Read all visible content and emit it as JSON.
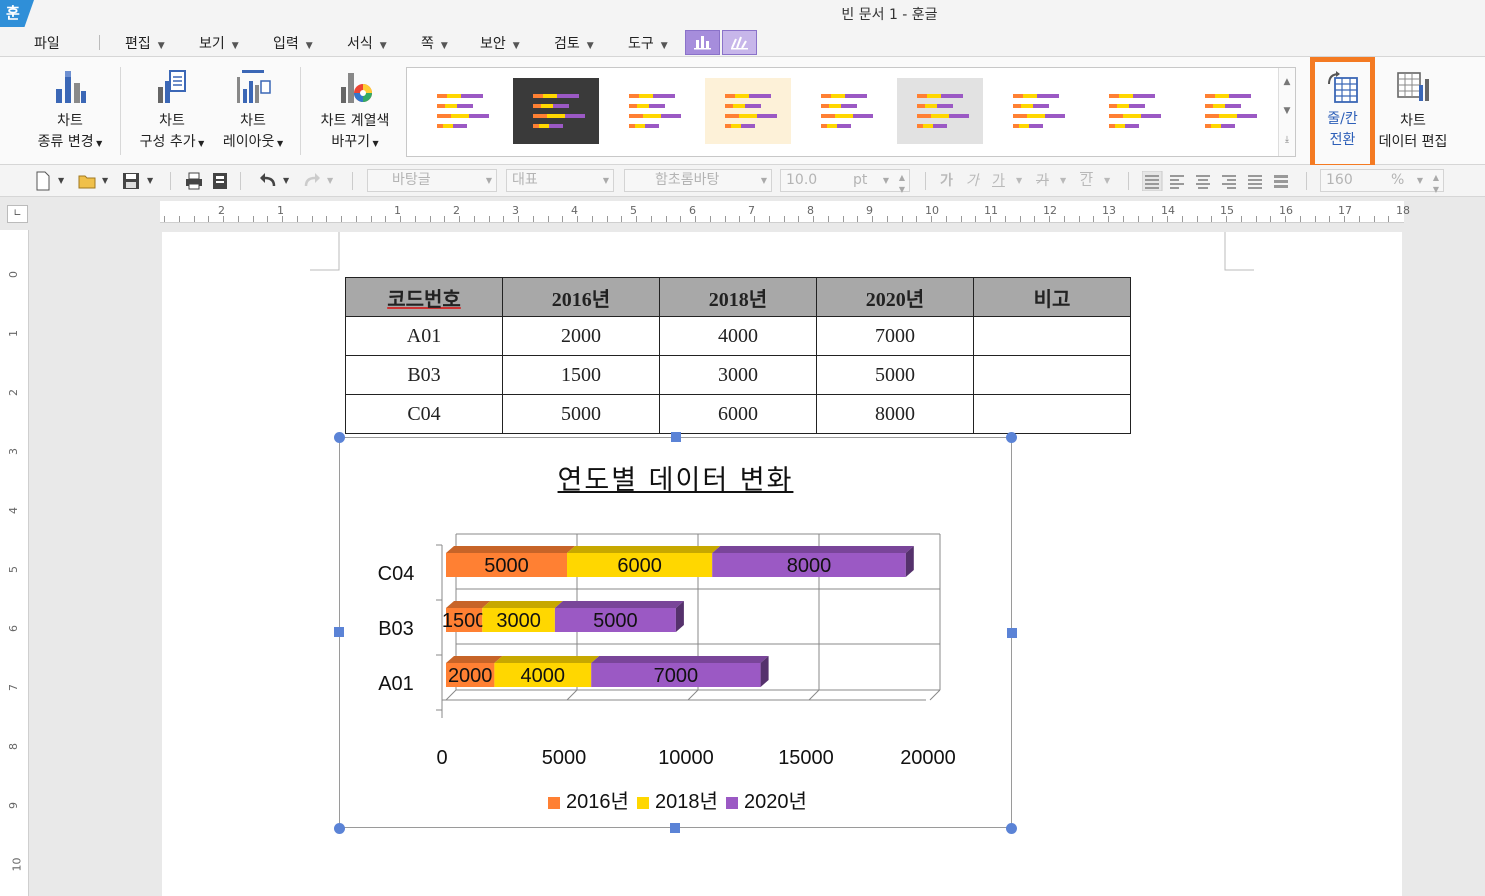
{
  "app": {
    "title": "빈 문서 1 - 훈글",
    "logo_text": "훈"
  },
  "menu": {
    "items": [
      {
        "label": "파일",
        "arrow": false
      },
      {
        "label": "편집",
        "arrow": true
      },
      {
        "label": "보기",
        "arrow": true
      },
      {
        "label": "입력",
        "arrow": true
      },
      {
        "label": "서식",
        "arrow": true
      },
      {
        "label": "쪽",
        "arrow": true
      },
      {
        "label": "보안",
        "arrow": true
      },
      {
        "label": "검토",
        "arrow": true
      },
      {
        "label": "도구",
        "arrow": true
      }
    ],
    "context_tabs": [
      "chart-icon",
      "chart-draw-icon"
    ]
  },
  "ribbon": {
    "chart_type_line1": "차트",
    "chart_type_line2": "종류 변경",
    "chart_compose_line1": "차트",
    "chart_compose_line2": "구성 추가",
    "chart_layout_line1": "차트",
    "chart_layout_line2": "레이아웃",
    "series_color_line1": "차트 계열색",
    "series_color_line2": "바꾸기",
    "swap_line1": "줄/칸",
    "swap_line2": "전환",
    "edit_data_line1": "차트",
    "edit_data_line2": "데이터 편집",
    "gallery_thumbs": 9
  },
  "toolbar": {
    "style_value": "바탕글",
    "outline_value": "대표",
    "font_value": "함초롬바탕",
    "size_value": "10.0",
    "size_unit": "pt",
    "zoom_value": "160",
    "zoom_unit": "%"
  },
  "rulers": {
    "h_numbers": [
      "2",
      "1",
      "1",
      "2",
      "3",
      "4",
      "5",
      "6",
      "7",
      "8",
      "9",
      "10",
      "11",
      "12",
      "13",
      "14",
      "15",
      "16",
      "17",
      "18"
    ],
    "v_numbers": [
      "0",
      "1",
      "2",
      "3",
      "4",
      "5",
      "6",
      "7",
      "8",
      "9",
      "10"
    ]
  },
  "table": {
    "headers": [
      "코드번호",
      "2016년",
      "2018년",
      "2020년",
      "비고"
    ],
    "rows": [
      [
        "A01",
        "2000",
        "4000",
        "7000",
        ""
      ],
      [
        "B03",
        "1500",
        "3000",
        "5000",
        ""
      ],
      [
        "C04",
        "5000",
        "6000",
        "8000",
        ""
      ]
    ]
  },
  "chart_data": {
    "type": "bar",
    "orientation": "horizontal",
    "stacked": true,
    "three_d": true,
    "title": "연도별 데이터 변화",
    "categories": [
      "A01",
      "B03",
      "C04"
    ],
    "series": [
      {
        "name": "2016년",
        "values": [
          2000,
          1500,
          5000
        ],
        "color": "#ff8033"
      },
      {
        "name": "2018년",
        "values": [
          4000,
          3000,
          6000
        ],
        "color": "#ffd700"
      },
      {
        "name": "2020년",
        "values": [
          7000,
          5000,
          8000
        ],
        "color": "#9b59c4"
      }
    ],
    "xlim": [
      0,
      20000
    ],
    "xticks": [
      "0",
      "5000",
      "10000",
      "15000",
      "20000"
    ],
    "grid": true,
    "legend": "bottom",
    "data_labels": true
  },
  "colors": {
    "accent_highlight": "#f47a22",
    "selection_handle": "#5b83d6",
    "context_tab": "#a68ddc"
  }
}
